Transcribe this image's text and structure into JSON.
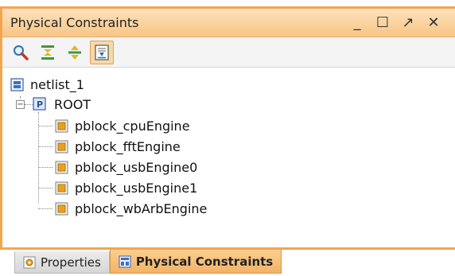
{
  "window": {
    "title": "Physical Constraints",
    "buttons": {
      "minimize": "_",
      "maximize": "☐",
      "float": "↗",
      "close": "✕"
    }
  },
  "toolbar": [
    {
      "name": "search-icon"
    },
    {
      "name": "collapse-all-icon"
    },
    {
      "name": "expand-all-icon"
    },
    {
      "name": "auto-fit-icon"
    }
  ],
  "tree": {
    "root": "netlist_1",
    "child": "ROOT",
    "items": [
      "pblock_cpuEngine",
      "pblock_fftEngine",
      "pblock_usbEngine0",
      "pblock_usbEngine1",
      "pblock_wbArbEngine"
    ]
  },
  "tabs": [
    {
      "label": "Properties",
      "active": false
    },
    {
      "label": "Physical Constraints",
      "active": true
    }
  ],
  "colors": {
    "accent": "#f2a64e",
    "pblock_icon": "#e6a21f"
  }
}
